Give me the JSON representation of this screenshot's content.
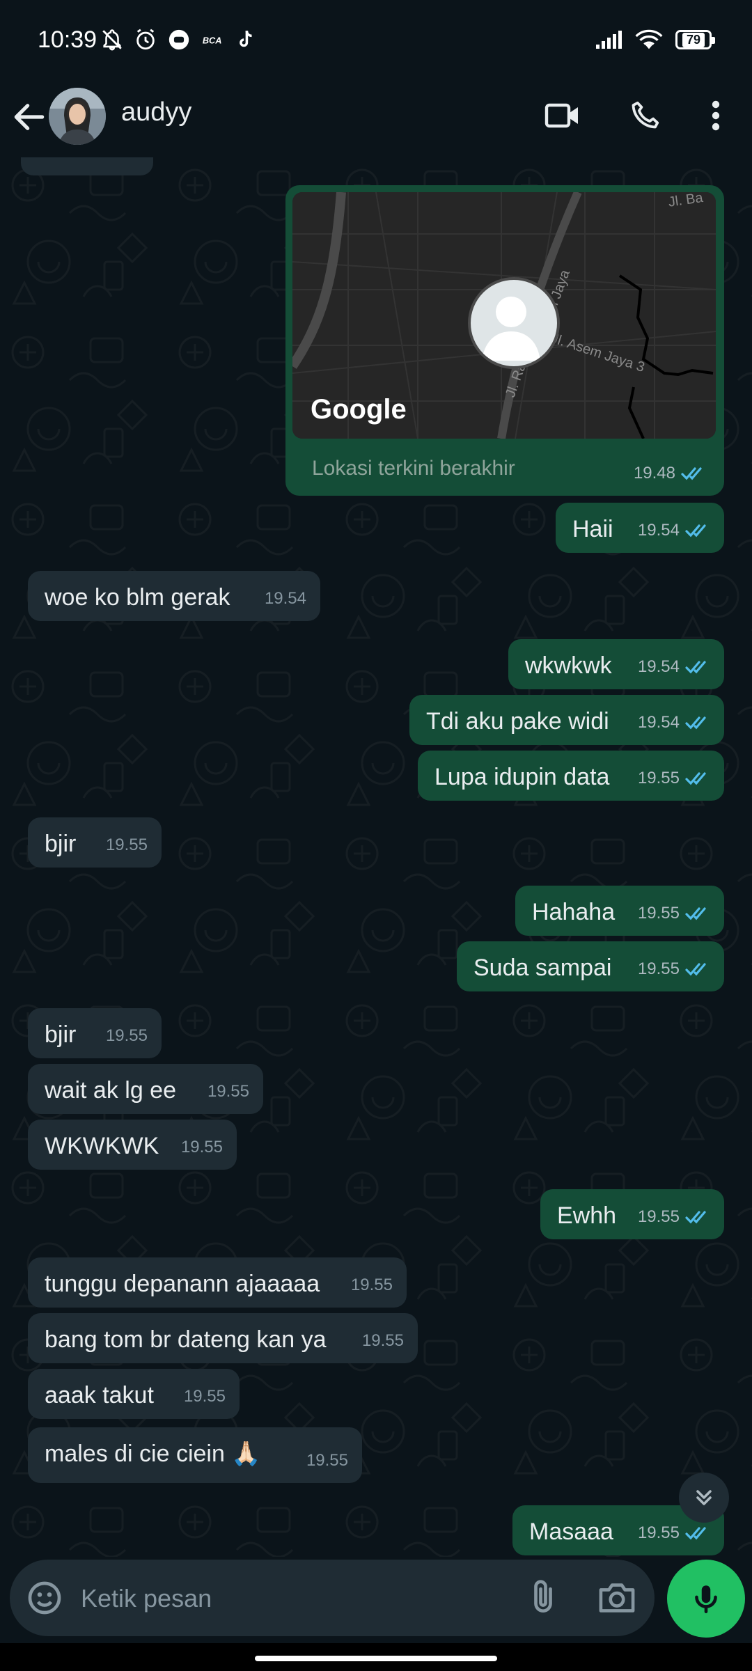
{
  "status_bar": {
    "time": "10:39",
    "battery": "79"
  },
  "header": {
    "contact_name": "audyy"
  },
  "location_message": {
    "map_brand": "Google",
    "map_labels": [
      "Jl. Ba",
      "n Jaya",
      "Jl. Raya",
      "Jl. Asem Jaya 3"
    ],
    "caption": "Lokasi terkini berakhir",
    "time": "19.48"
  },
  "messages": [
    {
      "dir": "out",
      "text": "Haii",
      "time": "19.54"
    },
    {
      "dir": "in",
      "text": "woe ko blm gerak",
      "time": "19.54"
    },
    {
      "dir": "out",
      "text": "wkwkwk",
      "time": "19.54"
    },
    {
      "dir": "out",
      "text": "Tdi aku pake widi",
      "time": "19.54"
    },
    {
      "dir": "out",
      "text": "Lupa idupin data",
      "time": "19.55"
    },
    {
      "dir": "in",
      "text": "bjir",
      "time": "19.55"
    },
    {
      "dir": "out",
      "text": "Hahaha",
      "time": "19.55"
    },
    {
      "dir": "out",
      "text": "Suda sampai",
      "time": "19.55"
    },
    {
      "dir": "in",
      "text": "bjir",
      "time": "19.55"
    },
    {
      "dir": "in",
      "text": "wait ak lg ee",
      "time": "19.55"
    },
    {
      "dir": "in",
      "text": "WKWKWK",
      "time": "19.55"
    },
    {
      "dir": "out",
      "text": "Ewhh",
      "time": "19.55"
    },
    {
      "dir": "in",
      "text": "tunggu depanann ajaaaaa",
      "time": "19.55"
    },
    {
      "dir": "in",
      "text": "bang tom br dateng kan ya",
      "time": "19.55"
    },
    {
      "dir": "in",
      "text": "aaak takut",
      "time": "19.55"
    },
    {
      "dir": "in",
      "text": "males di cie ciein 🙏🏻",
      "time": "19.55"
    },
    {
      "dir": "out",
      "text": "Masaaa",
      "time": "19.55"
    }
  ],
  "composer": {
    "placeholder": "Ketik pesan"
  },
  "colors": {
    "outgoing": "#144d37",
    "incoming": "#1f2c34",
    "read_ticks": "#53bdeb",
    "mic": "#21c063",
    "background": "#0b141a"
  },
  "icons": [
    "back-arrow-icon",
    "video-call-icon",
    "voice-call-icon",
    "more-vert-icon",
    "double-check-icon",
    "emoji-icon",
    "attach-icon",
    "camera-icon",
    "mic-icon",
    "chevron-double-down-icon"
  ]
}
